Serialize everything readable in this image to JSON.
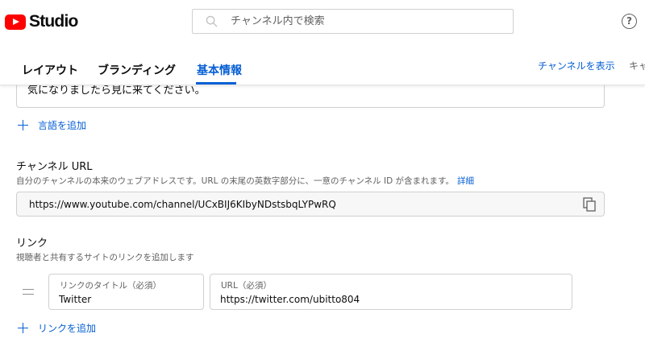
{
  "header": {
    "logo_text": "Studio",
    "search_placeholder": "チャンネル内で検索",
    "help_glyph": "?"
  },
  "tabs": [
    {
      "label": "レイアウト",
      "active": false
    },
    {
      "label": "ブランディング",
      "active": false
    },
    {
      "label": "基本情報",
      "active": true
    }
  ],
  "actions": {
    "view_channel": "チャンネルを表示",
    "cancel_partial": "キャ"
  },
  "description": {
    "visible_text": "気になりましたら見に来てください。"
  },
  "add_language_label": "言語を追加",
  "channel_url": {
    "title": "チャンネル URL",
    "subtitle": "自分のチャンネルの本来のウェブアドレスです。URL の末尾の英数字部分に、一意のチャンネル ID が含まれます。",
    "more_link": "詳細",
    "value": "https://www.youtube.com/channel/UCxBIJ6KIbyNDstsbqLYPwRQ"
  },
  "links": {
    "title": "リンク",
    "subtitle": "視聴者と共有するサイトのリンクを追加します",
    "items": [
      {
        "title_label": "リンクのタイトル（必須）",
        "title_value": "Twitter",
        "url_label": "URL（必須）",
        "url_value": "https://twitter.com/ubitto804"
      }
    ],
    "add_label": "リンクを追加"
  },
  "colors": {
    "accent": "#065fd4",
    "logo_red": "#ff0000",
    "text": "#0d0d0d",
    "secondary_text": "#606060",
    "border": "#d0d0d0"
  }
}
